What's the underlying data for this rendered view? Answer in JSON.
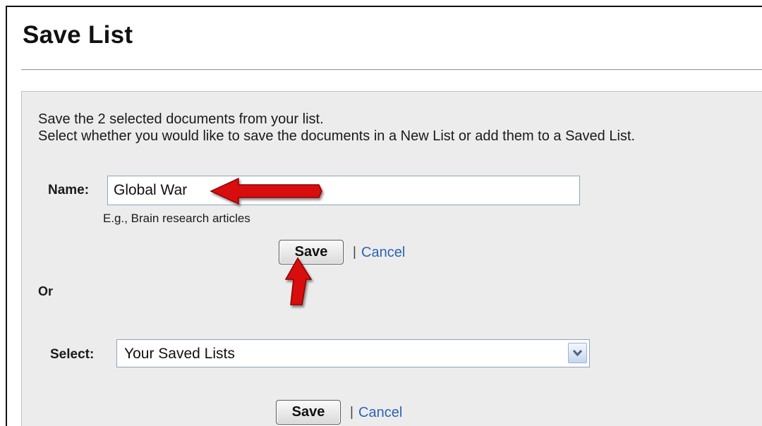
{
  "page": {
    "title": "Save List"
  },
  "panel": {
    "intro_line1": "Save the 2 selected documents from your list.",
    "intro_line2": "Select whether you would like to save the documents in a New List or add them to a Saved List."
  },
  "new_list": {
    "name_label": "Name:",
    "name_value": "Global War",
    "hint": "E.g., Brain research articles",
    "save_label": "Save",
    "separator": "|",
    "cancel_label": "Cancel"
  },
  "or_label": "Or",
  "saved_list": {
    "select_label": "Select:",
    "selected_option": "Your Saved Lists",
    "save_label": "Save",
    "separator": "|",
    "cancel_label": "Cancel"
  },
  "annotations": {
    "arrow_color": "#d81010",
    "icons": [
      "arrow-left-icon",
      "arrow-up-icon",
      "chevron-down-icon"
    ]
  }
}
